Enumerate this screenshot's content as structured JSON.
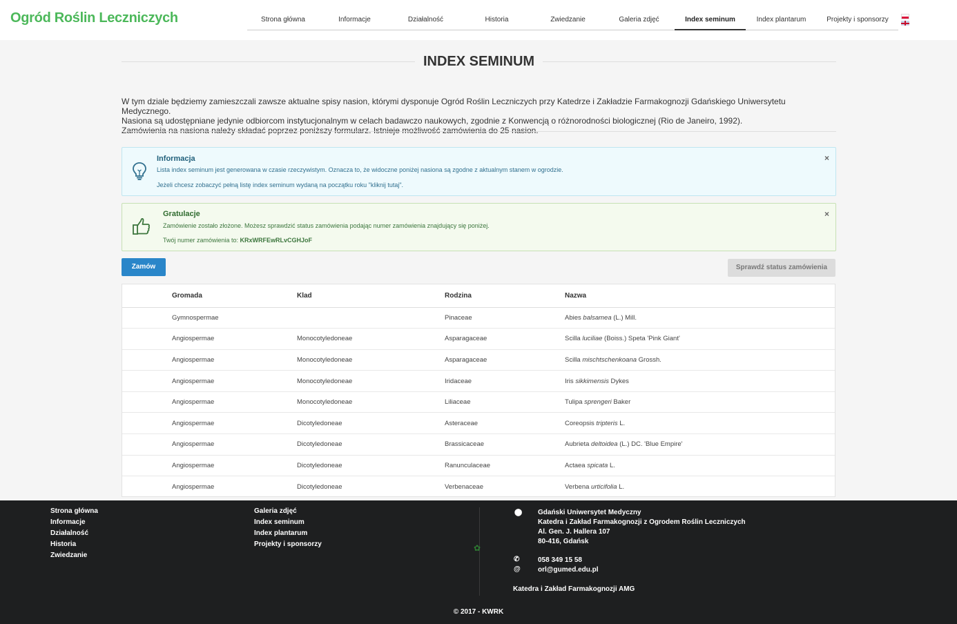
{
  "header": {
    "logo": "Ogród Roślin Leczniczych",
    "nav": [
      {
        "label": "Strona główna",
        "active": false
      },
      {
        "label": "Informacje",
        "active": false
      },
      {
        "label": "Działalność",
        "active": false
      },
      {
        "label": "Historia",
        "active": false
      },
      {
        "label": "Zwiedzanie",
        "active": false
      },
      {
        "label": "Galeria zdjęć",
        "active": false
      },
      {
        "label": "Index seminum",
        "active": true
      },
      {
        "label": "Index plantarum",
        "active": false
      },
      {
        "label": "Projekty i sponsorzy",
        "active": false
      }
    ]
  },
  "main": {
    "title": "INDEX SEMINUM",
    "intro": [
      "W tym dziale będziemy zamieszczali zawsze aktualne spisy nasion, którymi dysponuje Ogród Roślin Leczniczych przy Katedrze i Zakładzie Farmakognozji Gdańskiego Uniwersytetu Medycznego.",
      "Nasiona są udostępniane jedynie odbiorcom instytucjonalnym w celach badawczo naukowych, zgodnie z Konwencją o różnorodności biologicznej (Rio de Janeiro, 1992).",
      "Zamówienia na nasiona należy składać poprzez poniższy formularz. Istnieje możliwość zamówienia do 25 nasion."
    ],
    "alert_info": {
      "title": "Informacja",
      "text1": "Lista index seminum jest generowana w czasie rzeczywistym. Oznacza to, że widoczne poniżej nasiona są zgodne z aktualnym stanem w ogrodzie.",
      "text2": "Jeżeli chcesz zobaczyć pełną listę index seminum wydaną na początku roku \"kliknij tutaj\".",
      "close": "×"
    },
    "alert_success": {
      "title": "Gratulacje",
      "text1": "Zamówienie zostało złożone. Możesz sprawdzić status zamówienia podając numer zamówienia znajdujący się poniżej.",
      "text2_prefix": "Twój numer zamówienia to: ",
      "order_number": "KRxWRFEwRLvCGHJoF",
      "close": "×"
    },
    "btn_order": "Zamów",
    "btn_status": "Sprawdź status zamówienia",
    "table": {
      "headers": [
        "Gromada",
        "Klad",
        "Rodzina",
        "Nazwa"
      ],
      "rows": [
        [
          "Gymnospermae",
          "",
          "Pinaceae",
          "Abies",
          "balsamea",
          "(L.) Mill."
        ],
        [
          "Angiospermae",
          "Monocotyledoneae",
          "Asparagaceae",
          "Scilla",
          "luciliae",
          "(Boiss.) Speta 'Pink Giant'"
        ],
        [
          "Angiospermae",
          "Monocotyledoneae",
          "Asparagaceae",
          "Scilla",
          "mischtschenkoana",
          "Grossh."
        ],
        [
          "Angiospermae",
          "Monocotyledoneae",
          "Iridaceae",
          "Iris",
          "sikkimensis",
          "Dykes"
        ],
        [
          "Angiospermae",
          "Monocotyledoneae",
          "Liliaceae",
          "Tulipa",
          "sprengeri",
          "Baker"
        ],
        [
          "Angiospermae",
          "Dicotyledoneae",
          "Asteraceae",
          "Coreopsis",
          "tripteris",
          "L."
        ],
        [
          "Angiospermae",
          "Dicotyledoneae",
          "Brassicaceae",
          "Aubrieta",
          "deltoidea",
          "(L.) DC. 'Blue Empire'"
        ],
        [
          "Angiospermae",
          "Dicotyledoneae",
          "Ranunculaceae",
          "Actaea",
          "spicata",
          "L."
        ],
        [
          "Angiospermae",
          "Dicotyledoneae",
          "Verbenaceae",
          "Verbena",
          "urticifolia",
          "L."
        ]
      ]
    }
  },
  "footer": {
    "col1": [
      "Strona główna",
      "Informacje",
      "Działalność",
      "Historia",
      "Zwiedzanie"
    ],
    "col2": [
      "Galeria zdjęć",
      "Index seminum",
      "Index plantarum",
      "Projekty i sponsorzy"
    ],
    "address": [
      "Gdański Uniwersytet Medyczny",
      "Katedra i Zakład Farmakognozji z Ogrodem Roślin Leczniczych",
      "Al. Gen. J. Hallera 107",
      "80-416, Gdańsk"
    ],
    "phone": "058 349 15 58",
    "email": "orl@gumed.edu.pl",
    "dept": "Katedra i Zakład Farmakognozji AMG",
    "copyright": "© 2017 - KWRK"
  },
  "colors": {
    "logo": "#4cb85a",
    "primary_button": "#2a86c9",
    "footer_bg": "#1e1f20"
  }
}
